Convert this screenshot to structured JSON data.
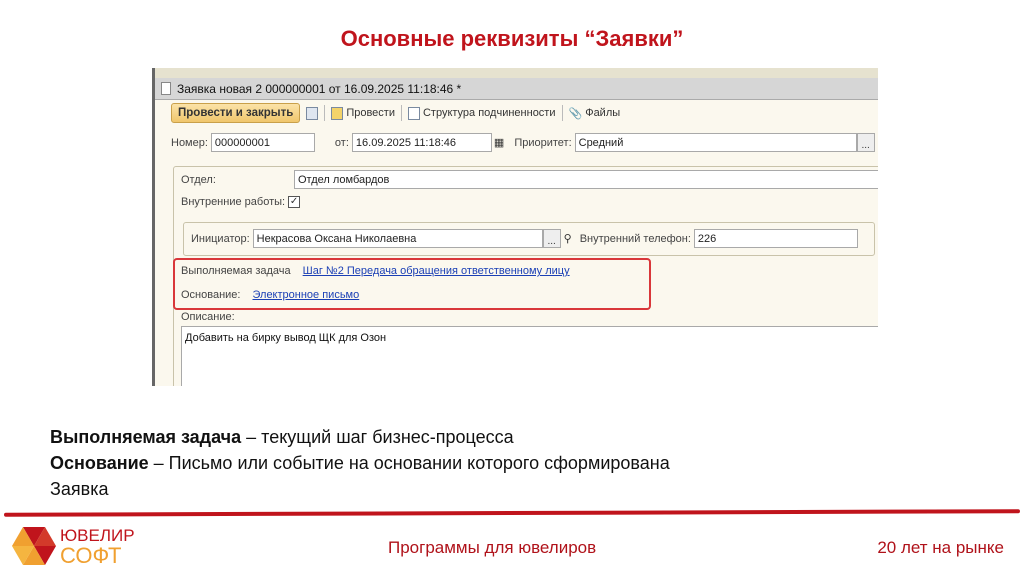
{
  "slide": {
    "title": "Основные реквизиты “Заявки”",
    "desc_lines": [
      {
        "bold": "Выполняемая задача",
        "rest": " – текущий шаг бизнес-процесса"
      },
      {
        "bold": "Основание",
        "rest": " – Письмо или событие на основании которого сформирована"
      },
      {
        "bold": "",
        "rest": "Заявка"
      }
    ],
    "footer": {
      "center": "Программы для ювелиров",
      "right": "20 лет на рынке",
      "logo_line1": "ЮВЕЛИР",
      "logo_line2": "СОФТ"
    },
    "accent": "#c0141c"
  },
  "window": {
    "title": "Заявка новая 2 000000001 от 16.09.2025 11:18:46 *",
    "toolbar": {
      "post_close": "Провести и закрыть",
      "post": "Провести",
      "structure": "Структура подчиненности",
      "files": "Файлы"
    },
    "form": {
      "number_label": "Номер:",
      "number": "000000001",
      "date_label": "от:",
      "date": "16.09.2025 11:18:46",
      "priority_label": "Приоритет:",
      "priority": "Средний",
      "dept_label": "Отдел:",
      "dept": "Отдел ломбардов",
      "internal_label": "Внутренние работы:",
      "internal_checked": true,
      "initiator_label": "Инициатор:",
      "initiator": "Некрасова Оксана Николаевна",
      "phone_label": "Внутренний телефон:",
      "phone": "226",
      "task_label": "Выполняемая задача",
      "task": "Шаг №2 Передача обращения ответственному лицу",
      "basis_label": "Основание:",
      "basis": "Электронное письмо",
      "desc_label": "Описание:",
      "desc": "Добавить на бирку вывод ЩК для Озон"
    }
  }
}
